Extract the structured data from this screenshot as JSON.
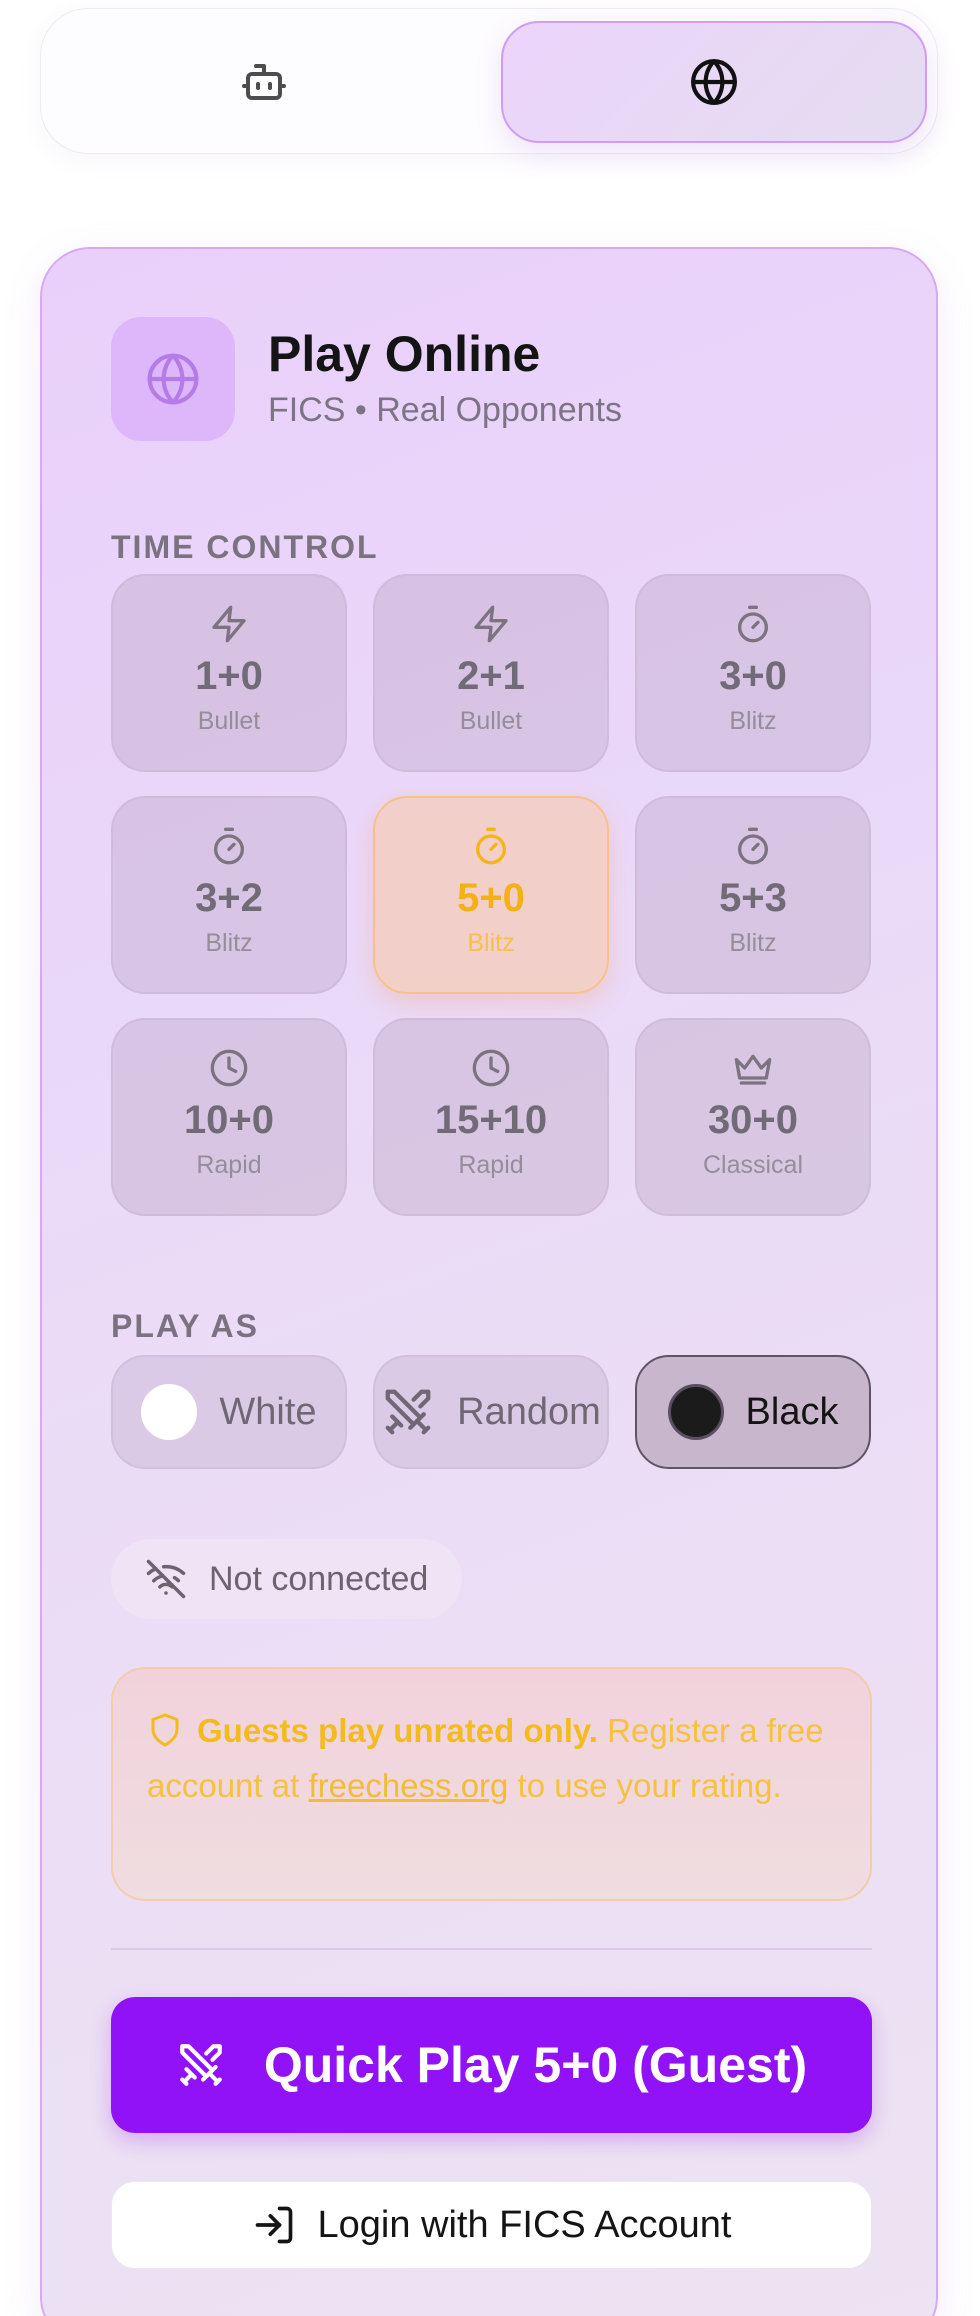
{
  "mode_switch": {
    "options": [
      {
        "icon": "bot-icon",
        "selected": false
      },
      {
        "icon": "globe-icon",
        "selected": true
      }
    ]
  },
  "header": {
    "icon": "globe-icon",
    "title": "Play Online",
    "subtitle": "FICS • Real Opponents"
  },
  "time_control": {
    "label": "TIME CONTROL",
    "selected_index": 4,
    "options": [
      {
        "time": "1+0",
        "category": "Bullet",
        "icon": "zap-icon"
      },
      {
        "time": "2+1",
        "category": "Bullet",
        "icon": "zap-icon"
      },
      {
        "time": "3+0",
        "category": "Blitz",
        "icon": "timer-icon"
      },
      {
        "time": "3+2",
        "category": "Blitz",
        "icon": "timer-icon"
      },
      {
        "time": "5+0",
        "category": "Blitz",
        "icon": "timer-icon"
      },
      {
        "time": "5+3",
        "category": "Blitz",
        "icon": "timer-icon"
      },
      {
        "time": "10+0",
        "category": "Rapid",
        "icon": "clock-icon"
      },
      {
        "time": "15+10",
        "category": "Rapid",
        "icon": "clock-icon"
      },
      {
        "time": "30+0",
        "category": "Classical",
        "icon": "crown-icon"
      }
    ]
  },
  "play_as": {
    "label": "PLAY AS",
    "selected": "Black",
    "options": [
      {
        "label": "White",
        "icon": "white-disc-icon"
      },
      {
        "label": "Random",
        "icon": "swords-icon"
      },
      {
        "label": "Black",
        "icon": "black-disc-icon"
      }
    ]
  },
  "connection": {
    "icon": "wifi-off-icon",
    "text": "Not connected"
  },
  "notice": {
    "icon": "shield-icon",
    "bold": "Guests play unrated only.",
    "text_before_link": " Register a free account at ",
    "link": "freechess.org",
    "text_after_link": " to use your rating."
  },
  "actions": {
    "quick_play": {
      "label": "Quick Play 5+0 (Guest)",
      "icon": "swords-icon"
    },
    "login": {
      "label": "Login with FICS Account",
      "icon": "log-in-icon"
    }
  },
  "colors": {
    "accent": "#9212f7",
    "selected_time": "#f4b113",
    "warning": "#f5c23f",
    "card_border": "#d8a9f3"
  }
}
